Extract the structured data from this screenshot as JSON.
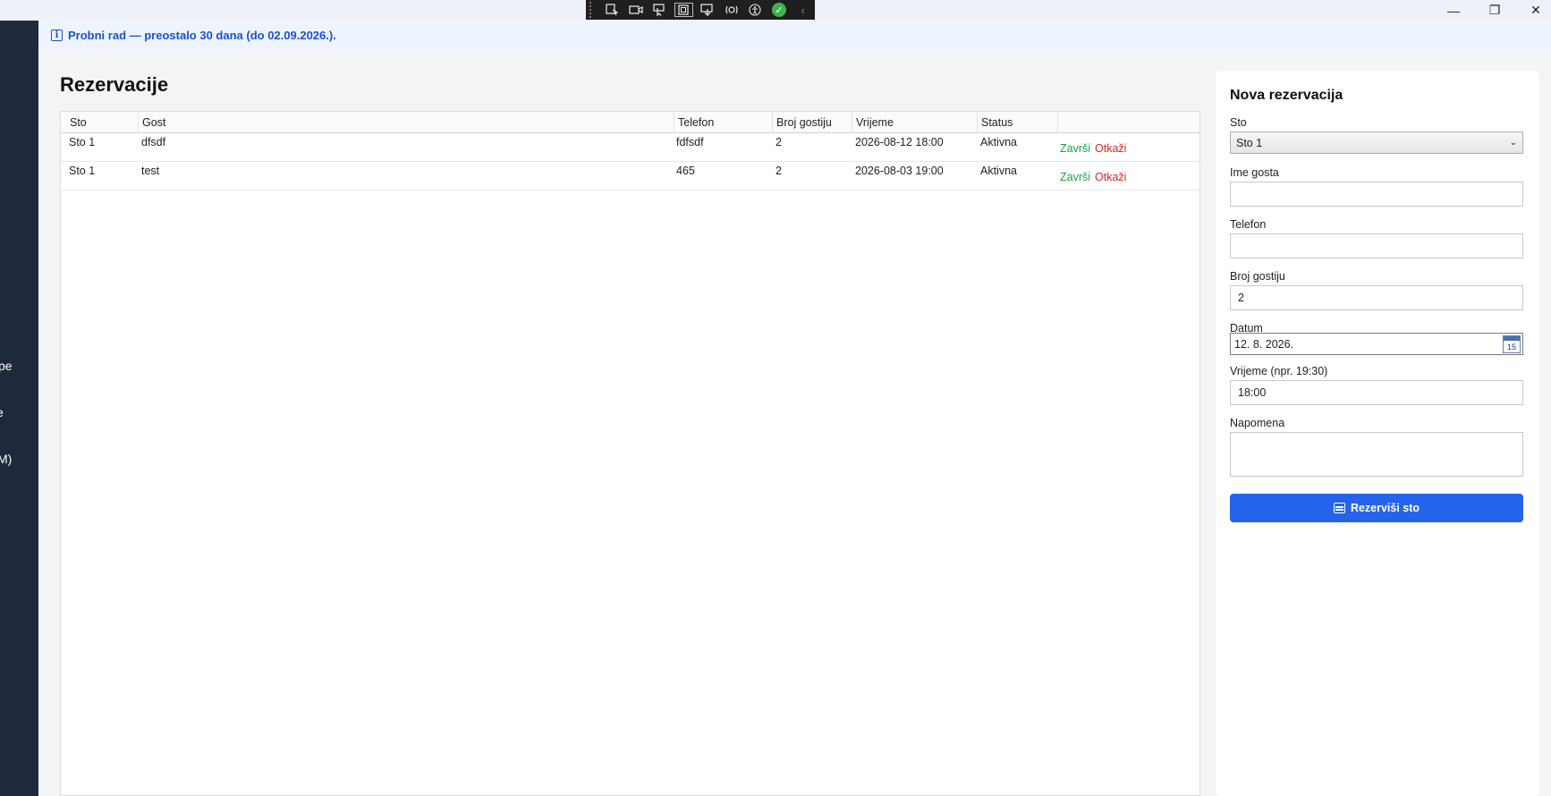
{
  "window": {
    "minimize_glyph": "—",
    "restore_glyph": "❐",
    "close_glyph": "✕"
  },
  "devtools": {
    "icons": [
      "select-element-icon",
      "video-icon",
      "pointer-icon",
      "layout-adorner-icon",
      "display-layout-icon",
      "hot-reload-icon",
      "accessibility-icon",
      "check-icon",
      "collapse-icon"
    ]
  },
  "sidebar": {
    "fragments": [
      "pe",
      "e",
      "M)"
    ]
  },
  "banner": {
    "info_glyph": "i",
    "text": "Probni rad — preostalo 30 dana (do 02.09.2026.)."
  },
  "main": {
    "title": "Rezervacije",
    "columns": [
      "Sto",
      "Gost",
      "Telefon",
      "Broj gostiju",
      "Vrijeme",
      "Status",
      ""
    ],
    "rows": [
      {
        "sto": "Sto 1",
        "gost": "dfsdf",
        "telefon": "fdfsdf",
        "broj": "2",
        "vrijeme": "2026-08-12 18:00",
        "status": "Aktivna",
        "done": "Završi",
        "cancel": "Otkaži"
      },
      {
        "sto": "Sto 1",
        "gost": "test",
        "telefon": "465",
        "broj": "2",
        "vrijeme": "2026-08-03 19:00",
        "status": "Aktivna",
        "done": "Završi",
        "cancel": "Otkaži"
      }
    ]
  },
  "form": {
    "title": "Nova rezervacija",
    "sto_label": "Sto",
    "sto_value": "Sto 1",
    "ime_label": "Ime gosta",
    "ime_value": "",
    "telefon_label": "Telefon",
    "telefon_value": "",
    "broj_label": "Broj gostiju",
    "broj_value": "2",
    "datum_label": "Datum",
    "datum_value": "12. 8. 2026.",
    "calendar_day": "15",
    "vrijeme_label": "Vrijeme (npr. 19:30)",
    "vrijeme_value": "18:00",
    "napomena_label": "Napomena",
    "napomena_value": "",
    "submit_label": "Rezerviši sto"
  },
  "colors": {
    "accent": "#2563eb",
    "sidebar": "#1e293b",
    "success": "#16a34a",
    "danger": "#dc2626",
    "banner_text": "#1d4ed8"
  }
}
